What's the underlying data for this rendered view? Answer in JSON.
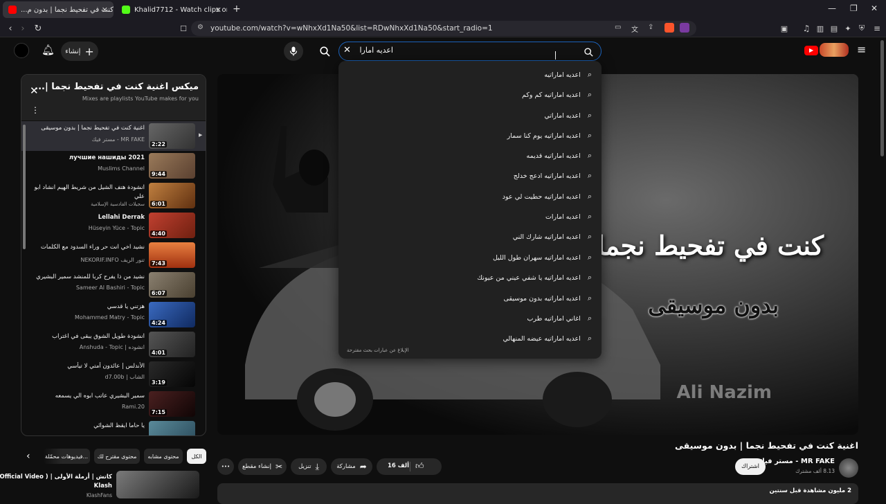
{
  "browser": {
    "tabs": [
      {
        "title": "اغنية كنت في تفحيط نجما | بدون م...",
        "fav_color": "#ff0000",
        "active": true
      },
      {
        "title": "Khalid7712 - Watch clips on Kick",
        "fav_color": "#53fc18",
        "active": false
      }
    ],
    "new_tab": "+",
    "url": "youtube.com/watch?v=wNhxXd1Na50&list=RDwNhxXd1Na50&start_radio=1"
  },
  "header": {
    "create_label": "إنشاء",
    "search_value": "اعديه امارا"
  },
  "suggestions": {
    "items": [
      "اعديه اماراتيه",
      "اعديه اماراتيه كم وكم",
      "اعديه اماراتي",
      "اعديه اماراتيه يوم كنا سمار",
      "اعديه اماراتيه قديمه",
      "اعديه اماراتيه ادعج خدلج",
      "اعديه اماراتيه حطيت لي عود",
      "اعديه امارات",
      "اعديه اماراتيه شارك الني",
      "اعديه اماراتيه سهران طول الليل",
      "اعديه اماراتيه يا شفي عيني من عيونك",
      "اعديه اماراتيه بدون موسيقى",
      "اغاني اماراتيه طرب",
      "اعديه اماراتيه عيضه المنهالي"
    ],
    "report": "الإبلاغ عن عبارات بحث مقترحة"
  },
  "playlist": {
    "title": "ميكس اغنية كنت في تفحيط نجما |...",
    "subtitle": "Mixes are playlists YouTube makes for you",
    "items": [
      {
        "title": "اغنية كنت في تفحيط نجما | بدون موسيقى",
        "channel": "مستر فيك - MR FAKE",
        "duration": "2:22",
        "color": "#555",
        "active": true
      },
      {
        "title": "лучшие нашиды 2021",
        "channel": "Muslims Channel",
        "duration": "9:44",
        "color": "#8a6a4a",
        "active": false
      },
      {
        "title": "انشودة هتف الشيل من شريط الهيم انشاد ابو علي",
        "channel": "سجيلات القادسية الإسلامية",
        "duration": "6:01",
        "color": "#a06a2a",
        "active": false
      },
      {
        "title": "Lellahi Derrak",
        "channel": "Hüseyin Yüce - Topic",
        "duration": "4:40",
        "color": "#b0442a",
        "active": false
      },
      {
        "title": "نشيد اخي انت حر وراء السدود مع الكلمات",
        "channel": "NEKORIF.INFO تنور الريف",
        "duration": "7:43",
        "color": "#d9662a",
        "active": false
      },
      {
        "title": "نشيد من ذا يفرح كربا للمنشد سمير البشيري",
        "channel": "Sameer Al Bashiri - Topic",
        "duration": "6:07",
        "color": "#7a7060",
        "active": false
      },
      {
        "title": "هزتني يا قدسي",
        "channel": "Mohammed Matry - Topic",
        "duration": "4:24",
        "color": "#2a4a8a",
        "active": false
      },
      {
        "title": "انشودة طويل الشوق يبقى في اغتراب",
        "channel": "Anshuda - Topic | انشوده",
        "duration": "4:01",
        "color": "#3a3a3a",
        "active": false
      },
      {
        "title": "الأندلس | عائدون أمتي لا تيأسي",
        "channel": "d7.00b | الشاب",
        "duration": "3:19",
        "color": "#1a1a1a",
        "active": false
      },
      {
        "title": "سمير البشيري عاتب ابوه الي يسمعه",
        "channel": "Rami.20",
        "duration": "7:15",
        "color": "#2a1a1a",
        "active": false
      },
      {
        "title": "يا حاما ايقظ الشوائي",
        "channel": "",
        "duration": "",
        "color": "#4a6a7a",
        "active": false
      }
    ]
  },
  "video": {
    "overlay_title": "كنت في تفحيط نجما",
    "overlay_sub": "بدون موسيقى",
    "watermark": "Ali Nazim",
    "title": "اغنية كنت في تفحيط نجما | بدون موسيقى",
    "channel": "مستر فيك - MR FAKE",
    "subscribers": "8.13 ألف مشترك",
    "subscribe_label": "اشتراك",
    "like_count": "16 ألف",
    "share_label": "مشاركة",
    "download_label": "تنزيل",
    "clip_label": "إنشاء مقطع",
    "more_label": "•••",
    "desc_line": "2 مليون مشاهدة قبل سنتين"
  },
  "chips": {
    "items": [
      "الكل",
      "محتوى مشابه",
      "محتوى مقترح لك",
      "فيديوهات محمّلة..."
    ],
    "selected": 0
  },
  "related": {
    "title": "كاتش | أرملة الأولى | ( Official Video )",
    "subtitle": "Klash",
    "channel": "KlashFans"
  }
}
